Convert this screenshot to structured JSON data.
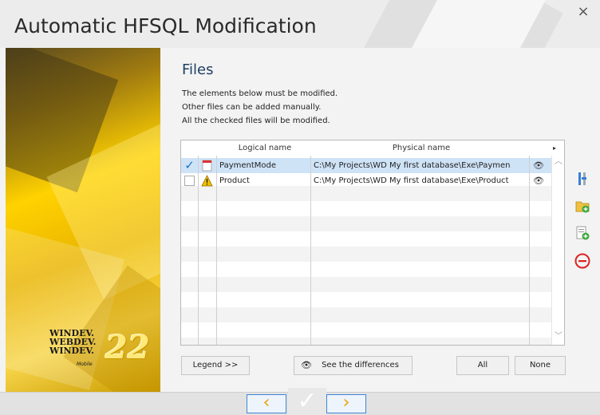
{
  "window": {
    "title": "Automatic HFSQL Modification",
    "close_symbol": "×"
  },
  "section": {
    "title": "Files",
    "lines": [
      "The elements below must be modified.",
      "Other files can be added manually.",
      "All the checked files will be modified."
    ]
  },
  "table": {
    "headers": {
      "logical": "Logical name",
      "physical": "Physical name",
      "more": "▸"
    },
    "rows": [
      {
        "checked": true,
        "status_icon": "file-red-icon",
        "logical": "PaymentMode",
        "physical": "C:\\My Projects\\WD My first database\\Exe\\Paymen"
      },
      {
        "checked": false,
        "status_icon": "warning-icon",
        "logical": "Product",
        "physical": "C:\\My Projects\\WD My first database\\Exe\\Product"
      }
    ],
    "eye_symbol": "👁",
    "scroll_up": "︿",
    "scroll_down": "﹀"
  },
  "buttons": {
    "legend": "Legend >>",
    "differences": "See the differences",
    "all": "All",
    "none": "None"
  },
  "brand": {
    "line1": "WINDEV.",
    "line2": "WEBDEV.",
    "line3": "WINDEV.",
    "mobile": "Mobile",
    "version": "22"
  },
  "nav": {
    "prev": "‹",
    "finish": "✓",
    "next": "›"
  },
  "colors": {
    "accent": "#1f3f63",
    "selection": "#cfe3f7",
    "nav_arrow": "#e8a400",
    "nav_border": "#3f86d6"
  }
}
